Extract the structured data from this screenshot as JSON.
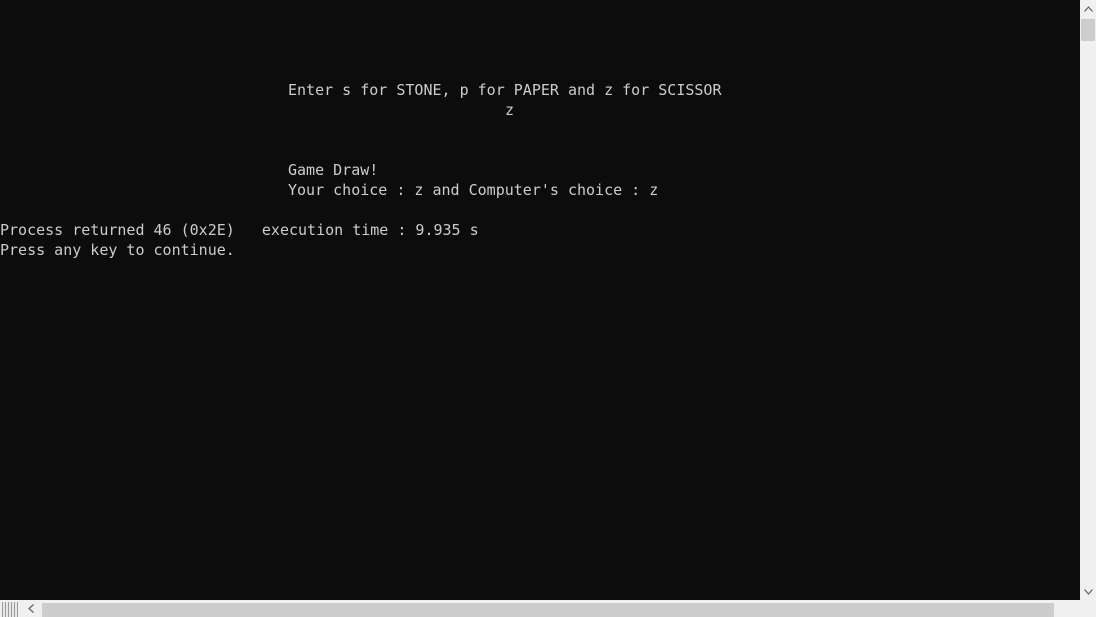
{
  "console": {
    "lines": [
      "Enter s for STONE, p for PAPER and z for SCISSOR",
      "z",
      "Game Draw!",
      "Your choice : z and Computer's choice : z",
      "Process returned 46 (0x2E)   execution time : 9.935 s",
      "Press any key to continue."
    ]
  },
  "scrollbars": {
    "vertical_up_icon": "chevron-up-icon",
    "vertical_down_icon": "chevron-down-icon",
    "horizontal_left_icon": "chevron-left-icon"
  }
}
